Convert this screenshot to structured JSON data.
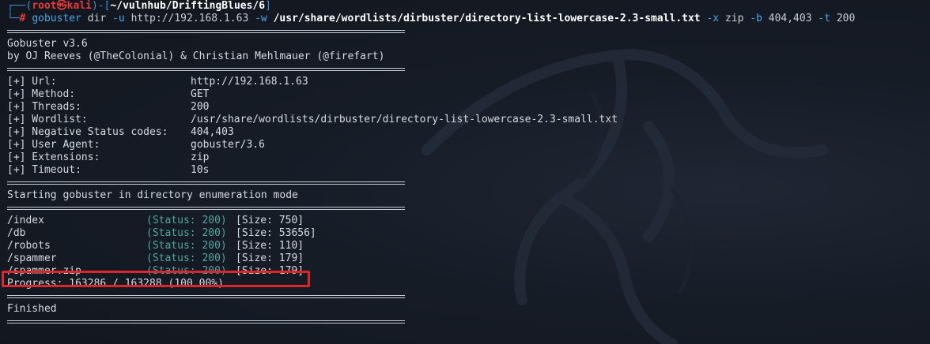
{
  "prompt": {
    "corner_top": "┌──(",
    "user": "root㉿kali",
    "mid": ")-[",
    "cwd": "~/vulnhub/DriftingBlues/6",
    "end": "]",
    "corner_bottom": "└─",
    "hash": "#"
  },
  "command": {
    "name": "gobuster",
    "mode": "dir",
    "u_flag": "-u",
    "url": "http://192.168.1.63",
    "w_flag": "-w",
    "wordlist": "/usr/share/wordlists/dirbuster/directory-list-lowercase-2.3-small.txt",
    "x_flag": "-x",
    "ext": "zip",
    "b_flag": "-b",
    "neg": "404,403",
    "t_flag": "-t",
    "threads": "200"
  },
  "banner": {
    "version": "Gobuster v3.6",
    "authors": "by OJ Reeves (@TheColonial) & Christian Mehlmauer (@firefart)"
  },
  "config": [
    {
      "key": "[+] Url:",
      "value": "http://192.168.1.63"
    },
    {
      "key": "[+] Method:",
      "value": "GET"
    },
    {
      "key": "[+] Threads:",
      "value": "200"
    },
    {
      "key": "[+] Wordlist:",
      "value": "/usr/share/wordlists/dirbuster/directory-list-lowercase-2.3-small.txt"
    },
    {
      "key": "[+] Negative Status codes:",
      "value": "404,403"
    },
    {
      "key": "[+] User Agent:",
      "value": "gobuster/3.6"
    },
    {
      "key": "[+] Extensions:",
      "value": "zip"
    },
    {
      "key": "[+] Timeout:",
      "value": "10s"
    }
  ],
  "start_msg": "Starting gobuster in directory enumeration mode",
  "results": [
    {
      "path": "/index",
      "status": "(Status: 200)",
      "size": "[Size: 750]"
    },
    {
      "path": "/db",
      "status": "(Status: 200)",
      "size": "[Size: 53656]"
    },
    {
      "path": "/robots",
      "status": "(Status: 200)",
      "size": "[Size: 110]"
    },
    {
      "path": "/spammer",
      "status": "(Status: 200)",
      "size": "[Size: 179]"
    },
    {
      "path": "/spammer.zip",
      "status": "(Status: 200)",
      "size": "[Size: 179]"
    }
  ],
  "progress": "Progress: 163286 / 163288 (100.00%)",
  "finished": "Finished",
  "colors": {
    "prompt_blue": "#3a8fd8",
    "prompt_red": "#e83a3a",
    "status_teal": "#4fa8a0",
    "highlight_red": "#e0242b",
    "background": "#161c26"
  }
}
